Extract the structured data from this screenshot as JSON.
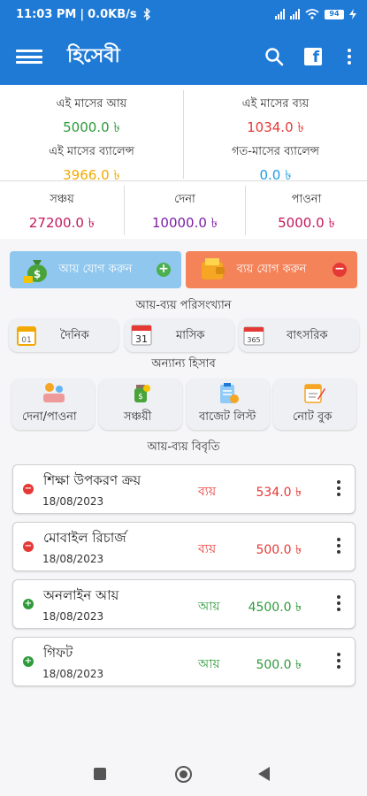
{
  "status": {
    "time": "11:03 PM",
    "speed": "0.0KB/s",
    "battery": "94"
  },
  "app": {
    "title": "হিসেবী"
  },
  "summary": {
    "income_label": "এই মাসের আয়",
    "income_value": "5000.0 ৳",
    "expense_label": "এই মাসের ব্যয়",
    "expense_value": "1034.0 ৳",
    "balance_label": "এই মাসের ব্যালেন্স",
    "balance_value": "3966.0 ৳",
    "prev_balance_label": "গত-মাসের ব্যালেন্স",
    "prev_balance_value": "0.0 ৳",
    "savings_label": "সঞ্চয়",
    "savings_value": "27200.0 ৳",
    "debt_label": "দেনা",
    "debt_value": "10000.0 ৳",
    "receivable_label": "পাওনা",
    "receivable_value": "5000.0 ৳"
  },
  "actions": {
    "add_income": "আয় যোগ করুন",
    "add_expense": "ব্যয় যোগ করুন"
  },
  "stats": {
    "title": "আয়-ব্যয় পরিসংখ্যান",
    "daily": "দৈনিক",
    "monthly": "মাসিক",
    "yearly": "বাৎসরিক",
    "calendar_month_day": "31",
    "calendar_year_day": "365",
    "calendar_day_day": "01"
  },
  "other": {
    "title": "অন্যান্য হিসাব",
    "debt": "দেনা/পাওনা",
    "savings": "সঞ্চয়ী",
    "budget": "বাজেট লিস্ট",
    "notebook": "নোট বুক"
  },
  "transactions": {
    "title": "আয়-ব্যয় বিবৃতি",
    "items": [
      {
        "title": "শিক্ষা উপকরণ ক্রয়",
        "date": "18/08/2023",
        "type": "ব্যয়",
        "amount": "534.0 ৳",
        "kind": "expense"
      },
      {
        "title": "মোবাইল রিচার্জ",
        "date": "18/08/2023",
        "type": "ব্যয়",
        "amount": "500.0 ৳",
        "kind": "expense"
      },
      {
        "title": "অনলাইন আয়",
        "date": "18/08/2023",
        "type": "আয়",
        "amount": "4500.0 ৳",
        "kind": "income"
      },
      {
        "title": "গিফট",
        "date": "18/08/2023",
        "type": "আয়",
        "amount": "500.0 ৳",
        "kind": "income"
      }
    ]
  },
  "colors": {
    "primary": "#1f7ad6",
    "income_green": "#2e9a3a",
    "expense_red": "#e53935",
    "balance_orange": "#f2a900",
    "prev_balance_blue": "#1e9be6",
    "savings_red": "#c2185b",
    "debt_purple": "#7b1fa2",
    "receivable_red": "#c2185b",
    "income_button": "#8fc7ee",
    "expense_button": "#f4835a"
  },
  "icons": {
    "menu": "hamburger-icon",
    "search": "search-icon",
    "facebook": "facebook-icon",
    "more": "more-vert-icon",
    "income": "money-bag-icon",
    "expense": "wallet-icon",
    "daily": "calendar-icon",
    "debt": "handshake-icon",
    "savings": "savings-jar-icon",
    "budget": "clipboard-icon",
    "notebook": "notebook-icon"
  }
}
